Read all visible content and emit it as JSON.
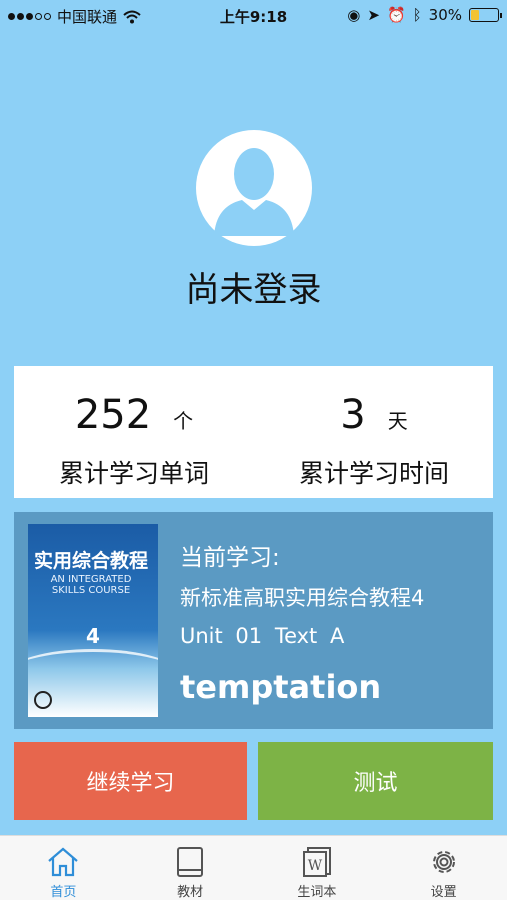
{
  "status_bar": {
    "carrier": "中国联通",
    "time": "上午9:18",
    "battery": "30%",
    "battery_level": 0.3
  },
  "profile": {
    "login_status": "尚未登录"
  },
  "stats": {
    "words": {
      "value": "252",
      "unit": "个",
      "label": "累计学习单词"
    },
    "time": {
      "value": "3",
      "unit": "天",
      "label": "累计学习时间"
    }
  },
  "current": {
    "label": "当前学习:",
    "book": "新标准高职实用综合教程4",
    "unit": "Unit 01  Text A",
    "word": "temptation",
    "cover": {
      "title": "实用综合教程",
      "subtitle": "AN INTEGRATED SKILLS COURSE",
      "number": "4"
    }
  },
  "actions": {
    "continue_label": "继续学习",
    "test_label": "测试"
  },
  "tabs": [
    {
      "label": "首页",
      "icon": "home-icon",
      "active": true
    },
    {
      "label": "教材",
      "icon": "book-icon",
      "active": false
    },
    {
      "label": "生词本",
      "icon": "wordbook-icon",
      "active": false
    },
    {
      "label": "设置",
      "icon": "gear-icon",
      "active": false
    }
  ],
  "colors": {
    "background": "#8dd0f6",
    "card_blue": "#5b9ac3",
    "continue": "#e7664d",
    "test": "#7db346",
    "tab_active": "#2f8ed8"
  }
}
